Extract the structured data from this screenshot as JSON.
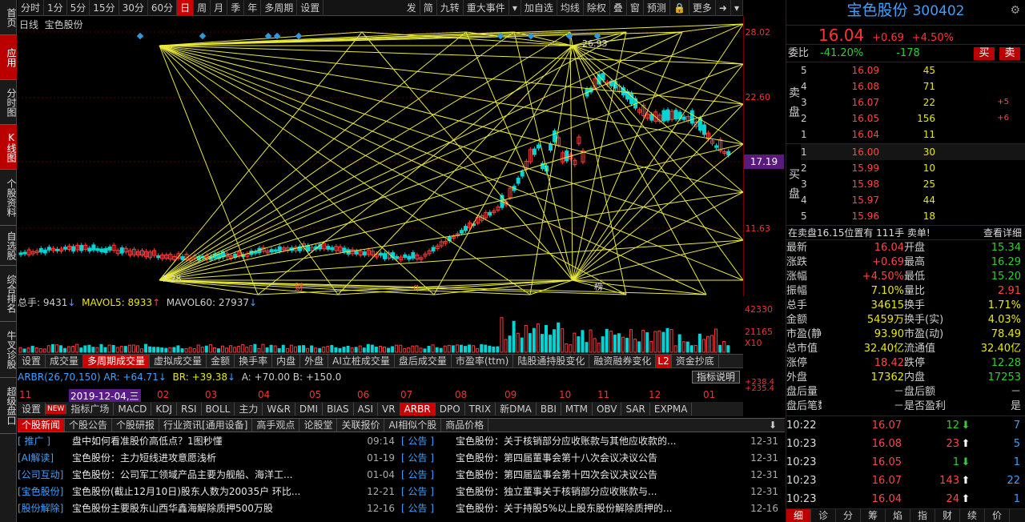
{
  "sidebar": [
    "首页",
    "应用",
    "分时图",
    "K线图",
    "个股资料",
    "自选股",
    "综合排名",
    "牛叉诊股",
    "超级盘口"
  ],
  "topbar": {
    "periods": [
      "分时",
      "1分",
      "5分",
      "15分",
      "30分",
      "60分",
      "日",
      "周",
      "月",
      "季",
      "年",
      "多周期",
      "设置"
    ],
    "right": [
      "发",
      "简",
      "九转",
      "重大事件",
      "加自选",
      "均线",
      "除权",
      "叠",
      "窗",
      "预测",
      "更多"
    ]
  },
  "chart": {
    "period_label": "日线",
    "stock": "宝色股份",
    "high_label": "26.93",
    "low_label": "7.28",
    "markers": [
      "财",
      "q",
      "榜"
    ],
    "axis": [
      "28.02",
      "22.60",
      "17.19",
      "11.63"
    ],
    "current": "17.19",
    "vol_axis": [
      "42330",
      "21165",
      "X10"
    ]
  },
  "vol": {
    "a": "总手: 9431",
    "b": "MAVOL5: 8933",
    "c": "MAVOL60: 27937"
  },
  "ind_tabs": [
    "设置",
    "成交量",
    "多周期成交量",
    "虚拟成交量",
    "金额",
    "换手率",
    "内盘",
    "外盘",
    "AI立桩成交量",
    "盘后成交量",
    "市盈率(ttm)",
    "陆股通持股变化",
    "融资融券变化",
    "资金抄底"
  ],
  "ind_tab_badge": "L2",
  "arbr": {
    "a": "ARBR(26,70,150) AR: +64.71",
    "b": "BR: +39.38",
    "c": "A: +70.00 B: +150.0",
    "btn": "指标说明",
    "axis": [
      "+238.4",
      "+235.4"
    ]
  },
  "dates": {
    "items": [
      "11",
      "02",
      "03",
      "04",
      "05",
      "06",
      "07",
      "08",
      "09",
      "10",
      "11",
      "12",
      "01"
    ],
    "highlight": "2019-12-04,三"
  },
  "ind2_tabs": [
    "设置",
    "NEW",
    "指标广场",
    "MACD",
    "KDJ",
    "RSI",
    "BOLL",
    "主力",
    "W&R",
    "DMI",
    "BIAS",
    "ASI",
    "VR",
    "ARBR",
    "DPO",
    "TRIX",
    "新DMA",
    "BBI",
    "MTM",
    "OBV",
    "SAR",
    "EXPMA"
  ],
  "news_tabs": [
    "个股新闻",
    "个股公告",
    "个股研报",
    "行业资讯[通用设备]",
    "高手观点",
    "论股堂",
    "关联报价",
    "AI相似个股",
    "商品价格"
  ],
  "news_left": [
    {
      "tag": "[ 推广 ]",
      "title": "盘中如何看准股价高低点？1图秒懂",
      "date": "09:14"
    },
    {
      "tag": "[AI解读]",
      "title": "宝色股份：主力短线进攻意愿浅析",
      "date": "01-19"
    },
    {
      "tag": "[公司互动]",
      "title": "宝色股份：公司军工领域产品主要为舰船、海洋工...",
      "date": "01-04"
    },
    {
      "tag": "[宝色股份]",
      "title": "宝色股份(截止12月10日)股东人数为20035户 环比...",
      "date": "12-21"
    },
    {
      "tag": "[股份解除]",
      "title": "宝色股份主要股东山西华鑫海解除质押500万股",
      "date": "12-16"
    }
  ],
  "news_right": [
    {
      "tag": "[ 公告 ]",
      "title": "宝色股份：关于核销部分应收账款与其他应收款的...",
      "date": "12-31"
    },
    {
      "tag": "[ 公告 ]",
      "title": "宝色股份：第四届董事会第十八次会议决议公告",
      "date": "12-31"
    },
    {
      "tag": "[ 公告 ]",
      "title": "宝色股份：第四届监事会第十四次会议决议公告",
      "date": "12-31"
    },
    {
      "tag": "[ 公告 ]",
      "title": "宝色股份：独立董事关于核销部分应收账款与...",
      "date": "12-31"
    },
    {
      "tag": "[ 公告 ]",
      "title": "宝色股份：关于持股5%以上股东股份解除质押的...",
      "date": "12-16"
    }
  ],
  "right": {
    "name": "宝色股份",
    "code": "300402",
    "price": "16.04",
    "chg": "+0.69",
    "pct": "+4.50%",
    "weibi_label": "委比",
    "weibi": "-41.20%",
    "weicha": "-178",
    "buy": "买",
    "sell": "卖",
    "sell_label": "卖盘",
    "buy_label": "买盘",
    "sells": [
      [
        "5",
        "16.09",
        "45",
        ""
      ],
      [
        "4",
        "16.08",
        "71",
        ""
      ],
      [
        "3",
        "16.07",
        "22",
        "+5"
      ],
      [
        "2",
        "16.05",
        "156",
        "+6"
      ],
      [
        "1",
        "16.04",
        "11",
        ""
      ]
    ],
    "buys": [
      [
        "1",
        "16.00",
        "30"
      ],
      [
        "2",
        "15.99",
        "10"
      ],
      [
        "3",
        "15.98",
        "25"
      ],
      [
        "4",
        "15.97",
        "44"
      ],
      [
        "5",
        "15.96",
        "18"
      ]
    ],
    "notice": "在卖盘16.15位置有 111手 卖单!",
    "detail": "查看详细",
    "quotes": [
      [
        "最新",
        "16.04",
        "开盘",
        "15.34"
      ],
      [
        "涨跌",
        "+0.69",
        "最高",
        "16.29"
      ],
      [
        "涨幅",
        "+4.50%",
        "最低",
        "15.20"
      ],
      [
        "振幅",
        "7.10%",
        "量比",
        "2.91"
      ],
      [
        "总手",
        "34615",
        "换手",
        "1.71%"
      ],
      [
        "金额",
        "5459万",
        "换手(实)",
        "4.03%"
      ],
      [
        "市盈(静)",
        "93.90",
        "市盈(动)",
        "78.49"
      ],
      [
        "总市值",
        "32.40亿",
        "流通值",
        "32.40亿"
      ],
      [
        "涨停",
        "18.42",
        "跌停",
        "12.28"
      ],
      [
        "外盘",
        "17362",
        "内盘",
        "17253"
      ],
      [
        "盘后量",
        "－",
        "盘后额",
        "－"
      ],
      [
        "盘后笔数",
        "－",
        "是否盈利",
        "是"
      ]
    ],
    "ticks": [
      [
        "10:22",
        "16.07",
        "12",
        "down",
        "7"
      ],
      [
        "10:23",
        "16.08",
        "23",
        "up",
        "5"
      ],
      [
        "10:23",
        "16.05",
        "1",
        "down",
        "1"
      ],
      [
        "10:23",
        "16.07",
        "143",
        "up",
        "22"
      ],
      [
        "10:23",
        "16.04",
        "24",
        "up",
        "1"
      ]
    ],
    "bottom_tabs": [
      "细",
      "诊",
      "分",
      "筹",
      "焰",
      "指",
      "财",
      "续",
      "价"
    ]
  }
}
